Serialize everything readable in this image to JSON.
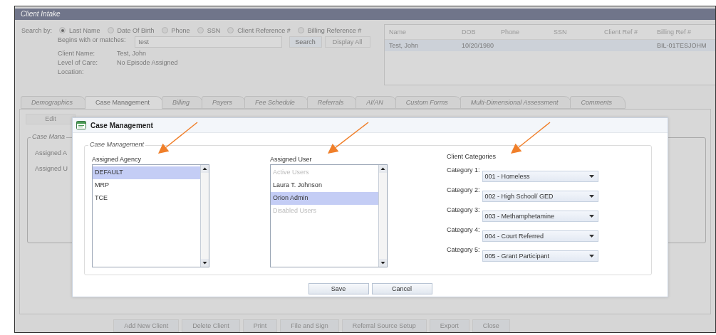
{
  "window": {
    "title": "Client Intake"
  },
  "search": {
    "label": "Search by:",
    "options": [
      {
        "label": "Last Name",
        "selected": true
      },
      {
        "label": "Date Of Birth",
        "selected": false
      },
      {
        "label": "Phone",
        "selected": false
      },
      {
        "label": "SSN",
        "selected": false
      },
      {
        "label": "Client Reference #",
        "selected": false
      },
      {
        "label": "Billing Reference #",
        "selected": false
      }
    ],
    "match_label": "Begins with or matches:",
    "match_value": "test",
    "buttons": [
      {
        "label": "Search",
        "disabled": false
      },
      {
        "label": "Display All",
        "disabled": true
      }
    ]
  },
  "client_info": [
    {
      "label": "Client Name:",
      "value": "Test, John"
    },
    {
      "label": "Level of Care:",
      "value": "No Episode Assigned"
    },
    {
      "label": "Location:"
    }
  ],
  "results": {
    "columns": [
      "Name",
      "DOB",
      "Phone",
      "SSN",
      "Client Ref #",
      "Billing Ref #"
    ],
    "rows": [
      {
        "name": "Test, John",
        "dob": "10/20/1980",
        "billing_ref": "BIL-01TESJOHM",
        "selected": true
      }
    ]
  },
  "tabs": [
    {
      "label": "Demographics",
      "selected": false
    },
    {
      "label": "Case Management",
      "selected": true
    },
    {
      "label": "Billing",
      "selected": false
    },
    {
      "label": "Payers",
      "selected": false
    },
    {
      "label": "Fee Schedule",
      "selected": false
    },
    {
      "label": "Referrals",
      "selected": false
    },
    {
      "label": "AI/AN",
      "selected": false
    },
    {
      "label": "Custom Forms",
      "selected": false
    },
    {
      "label": "Multi-Dimensional Assessment",
      "selected": false
    },
    {
      "label": "Comments",
      "selected": false
    }
  ],
  "panel": {
    "edit_button": "Edit",
    "legend": "Case Mana",
    "labels": [
      "Assigned A",
      "Assigned U"
    ]
  },
  "footer_buttons": [
    "Add New Client",
    "Delete Client",
    "Print",
    "File and Sign",
    "Referral Source Setup",
    "Export",
    "Close"
  ],
  "dialog": {
    "title": "Case Management",
    "group_title": "Case Management",
    "agency": {
      "label": "Assigned Agency",
      "items": [
        {
          "label": "DEFAULT",
          "kind": "item",
          "selected": true
        },
        {
          "label": "MRP",
          "kind": "item",
          "selected": false
        },
        {
          "label": "TCE",
          "kind": "item",
          "selected": false
        }
      ]
    },
    "user": {
      "label": "Assigned User",
      "items": [
        {
          "label": "Active Users",
          "kind": "header",
          "selected": false
        },
        {
          "label": "Laura T. Johnson",
          "kind": "item",
          "selected": false
        },
        {
          "label": "Orion Admin",
          "kind": "item",
          "selected": true
        },
        {
          "label": "Disabled Users",
          "kind": "header",
          "selected": false
        }
      ]
    },
    "categories": {
      "title": "Client Categories",
      "items": [
        {
          "label": "Category 1:",
          "value": "001 - Homeless"
        },
        {
          "label": "Category 2:",
          "value": "002 - High School/ GED"
        },
        {
          "label": "Category 3:",
          "value": "003 - Methamphetamine"
        },
        {
          "label": "Category 4:",
          "value": "004 - Court Referred"
        },
        {
          "label": "Category 5:",
          "value": "005 - Grant Participant"
        }
      ]
    },
    "buttons": [
      "Save",
      "Cancel"
    ]
  }
}
